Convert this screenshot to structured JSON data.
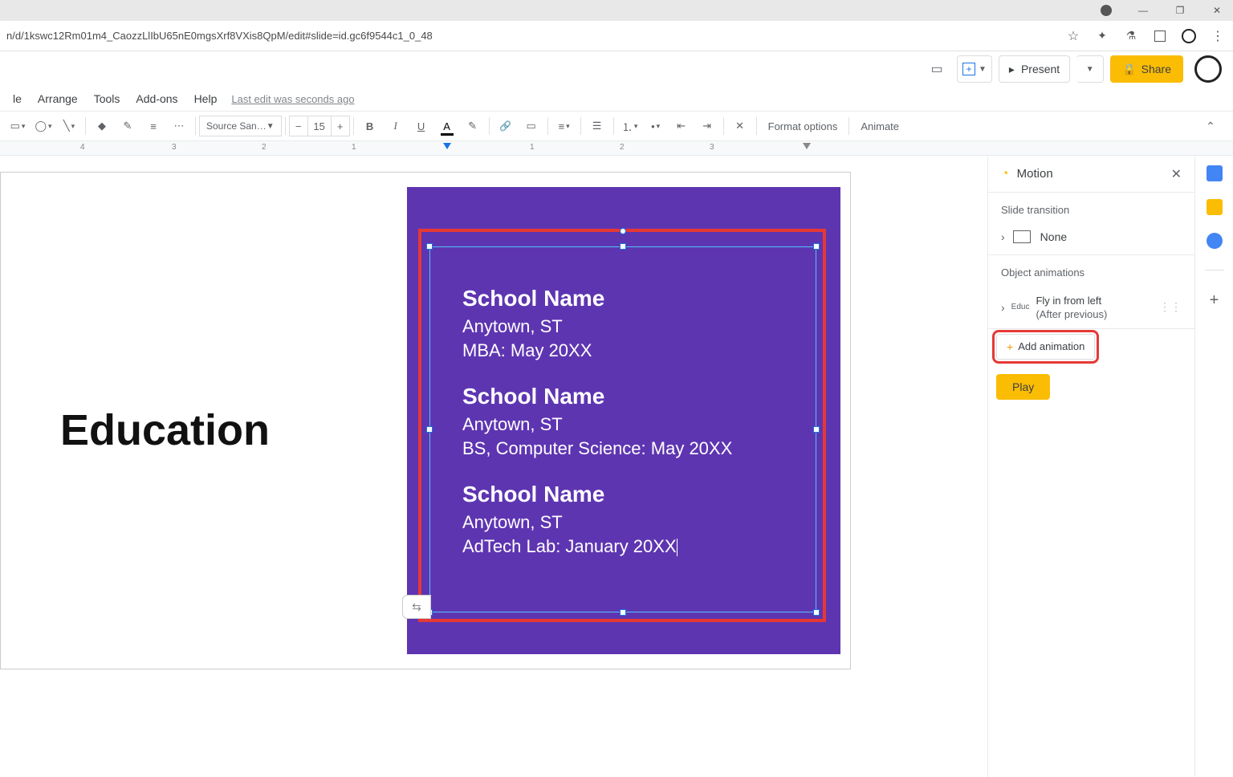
{
  "window": {
    "url": "n/d/1kswc12Rm01m4_CaozzLlIbU65nE0mgsXrf8VXis8QpM/edit#slide=id.gc6f9544c1_0_48"
  },
  "menubar": {
    "items": [
      "le",
      "Arrange",
      "Tools",
      "Add-ons",
      "Help"
    ],
    "last_edit": "Last edit was seconds ago"
  },
  "appbar": {
    "present": "Present",
    "share": "Share"
  },
  "toolbar": {
    "font": "Source San…",
    "size": "15",
    "format_options": "Format options",
    "animate": "Animate"
  },
  "ruler": {
    "marks": [
      {
        "pos": 100,
        "label": "4"
      },
      {
        "pos": 214,
        "label": "3"
      },
      {
        "pos": 326,
        "label": "2"
      },
      {
        "pos": 438,
        "label": "1"
      },
      {
        "pos": 660,
        "label": "1"
      },
      {
        "pos": 772,
        "label": "2"
      },
      {
        "pos": 884,
        "label": "3"
      }
    ]
  },
  "slide": {
    "title": "Education",
    "blocks": [
      {
        "school": "School Name",
        "location": "Anytown, ST",
        "detail": "MBA: May 20XX"
      },
      {
        "school": "School Name",
        "location": "Anytown, ST",
        "detail": "BS, Computer Science: May 20XX"
      },
      {
        "school": "School Name",
        "location": "Anytown, ST",
        "detail": "AdTech Lab: January 20XX"
      }
    ]
  },
  "motion": {
    "title": "Motion",
    "slide_transition_label": "Slide transition",
    "transition_name": "None",
    "object_animations_label": "Object animations",
    "anim_obj": "Educ",
    "anim_name": "Fly in from left",
    "anim_trigger": "(After previous)",
    "add_animation": "Add animation",
    "play": "Play"
  }
}
